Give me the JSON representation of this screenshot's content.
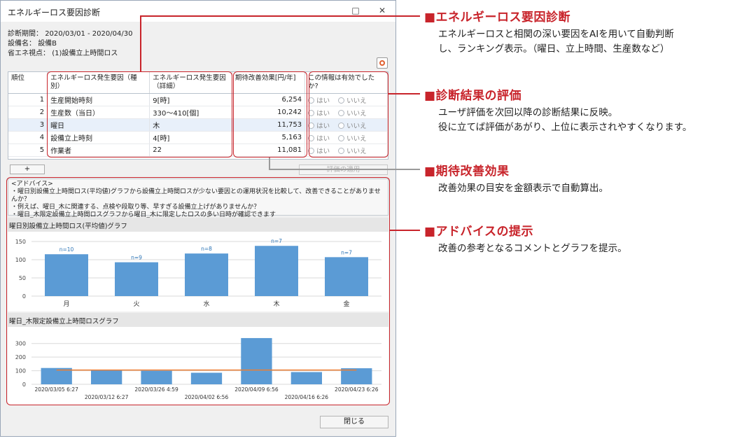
{
  "window": {
    "title": "エネルギーロス要因診断",
    "minimize": "□",
    "close": "✕"
  },
  "meta": {
    "period_label": "診断期間：",
    "period_value": "2020/03/01 - 2020/04/30",
    "equipment_label": "設備名：",
    "equipment_value": "設備B",
    "viewpoint_label": "省エネ視点：",
    "viewpoint_value": "(1)設備立上時間ロス"
  },
  "table": {
    "headers": [
      "順位",
      "エネルギーロス発生要因（種別）",
      "エネルギーロス発生要因（詳細）",
      "期待改善効果[円/年]",
      "この情報は有効でしたか?"
    ],
    "yes_label": "はい",
    "no_label": "いいえ",
    "rows": [
      {
        "rank": "1",
        "type": "生産開始時刻",
        "detail": "9[時]",
        "effect": "6,254"
      },
      {
        "rank": "2",
        "type": "生産数（当日）",
        "detail": "330～410[個]",
        "effect": "10,242"
      },
      {
        "rank": "3",
        "type": "曜日",
        "detail": "木",
        "effect": "11,753"
      },
      {
        "rank": "4",
        "type": "設備立上時刻",
        "detail": "4[時]",
        "effect": "5,163"
      },
      {
        "rank": "5",
        "type": "作業者",
        "detail": "22",
        "effect": "11,081"
      }
    ]
  },
  "buttons": {
    "add": "+",
    "apply": "評価の適用",
    "close": "閉じる"
  },
  "advice": {
    "lines": [
      "<アドバイス>",
      "・曜日別設備立上時間ロス(平均値)グラフから設備立上時間ロスが少ない要因との運用状況を比較して、改善できることがありませんか？",
      "・例えば、曜日_木に関連する、点検や段取り等、早すぎる設備立上げがありませんか？",
      "・曜日_木限定設備立上時間ロスグラフから曜日_木に限定したロスの多い日時が確認できます"
    ]
  },
  "chart_data": [
    {
      "type": "bar",
      "title": "曜日別設備立上時間ロス(平均値)グラフ",
      "categories": [
        "月",
        "火",
        "水",
        "木",
        "金"
      ],
      "values": [
        115,
        93,
        117,
        138,
        107
      ],
      "labels": [
        "n=10",
        "n=9",
        "n=8",
        "n=7",
        "n=7"
      ],
      "ylim": [
        0,
        150
      ],
      "yticks": [
        "0",
        "50",
        "100",
        "150"
      ],
      "grid": true,
      "color": "#5b9bd5"
    },
    {
      "type": "bar",
      "title": "曜日_木限定設備立上時間ロスグラフ",
      "categories": [
        "2020/03/05 6:27",
        "2020/03/12 6:27",
        "2020/03/26 4:59",
        "2020/04/02 6:56",
        "2020/04/09 6:56",
        "2020/04/16 6:26",
        "2020/04/23 6:26"
      ],
      "values": [
        120,
        105,
        100,
        85,
        340,
        90,
        118
      ],
      "line_value": 105,
      "ylim": [
        0,
        350
      ],
      "yticks": [
        "0",
        "100",
        "200",
        "300"
      ],
      "grid": true,
      "color": "#5b9bd5",
      "line_color": "#ed7d31"
    }
  ],
  "callouts": [
    {
      "title": "■エネルギーロス要因診断",
      "body": [
        "エネルギーロスと相関の深い要因をAIを用いて自動判断",
        "し、ランキング表示。（曜日、立上時間、生産数など）"
      ]
    },
    {
      "title": "■診断結果の評価",
      "body": [
        "ユーザ評価を次回以降の診断結果に反映。",
        "役に立てば評価があがり、上位に表示されやすくなります。"
      ]
    },
    {
      "title": "■期待改善効果",
      "body": [
        "改善効果の目安を金額表示で自動算出。"
      ]
    },
    {
      "title": "■アドバイスの提示",
      "body": [
        "改善の参考となるコメントとグラフを提示。"
      ]
    }
  ],
  "colors": {
    "accent_red": "#c8242b",
    "bar_blue": "#5b9bd5",
    "line_orange": "#ed7d31"
  }
}
